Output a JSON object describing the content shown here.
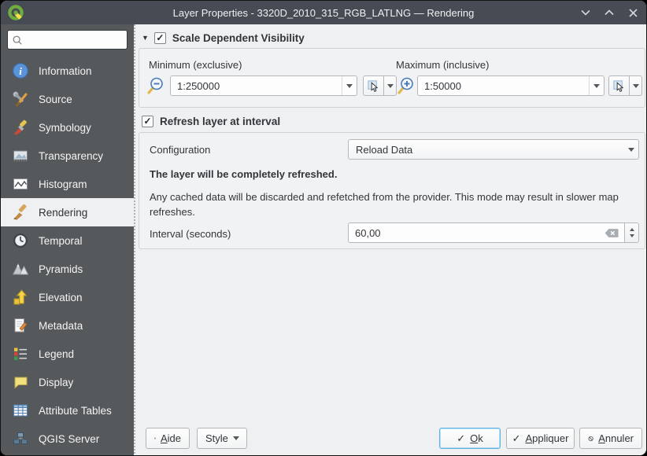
{
  "window": {
    "title": "Layer Properties - 3320D_2010_315_RGB_LATLNG — Rendering"
  },
  "sidebar": {
    "search_placeholder": "",
    "items": [
      {
        "label": "Information",
        "selected": false
      },
      {
        "label": "Source",
        "selected": false
      },
      {
        "label": "Symbology",
        "selected": false
      },
      {
        "label": "Transparency",
        "selected": false
      },
      {
        "label": "Histogram",
        "selected": false
      },
      {
        "label": "Rendering",
        "selected": true
      },
      {
        "label": "Temporal",
        "selected": false
      },
      {
        "label": "Pyramids",
        "selected": false
      },
      {
        "label": "Elevation",
        "selected": false
      },
      {
        "label": "Metadata",
        "selected": false
      },
      {
        "label": "Legend",
        "selected": false
      },
      {
        "label": "Display",
        "selected": false
      },
      {
        "label": "Attribute Tables",
        "selected": false
      },
      {
        "label": "QGIS Server",
        "selected": false
      }
    ]
  },
  "rendering": {
    "scale": {
      "title": "Scale Dependent Visibility",
      "checked": true,
      "minimum_label": "Minimum (exclusive)",
      "minimum_value": "1:250000",
      "maximum_label": "Maximum (inclusive)",
      "maximum_value": "1:50000"
    },
    "refresh": {
      "title": "Refresh layer at interval",
      "checked": true,
      "configuration_label": "Configuration",
      "configuration_value": "Reload Data",
      "summary": "The layer will be completely refreshed.",
      "description": "Any cached data will be discarded and refetched from the provider. This mode may result in slower map refreshes.",
      "interval_label": "Interval (seconds)",
      "interval_value": "60,00"
    }
  },
  "footer": {
    "help": "Aide",
    "style": "Style",
    "ok": "Ok",
    "apply": "Appliquer",
    "cancel": "Annuler"
  },
  "icons": {
    "check": "✓",
    "collapse": "▼"
  },
  "colors": {
    "titlebar": "#474c54",
    "sidebar": "#56595b",
    "background": "#eff0f1",
    "accent": "#3daee9"
  }
}
